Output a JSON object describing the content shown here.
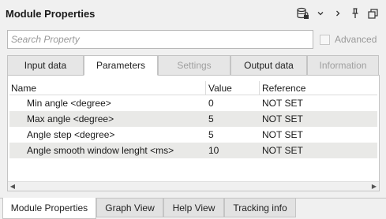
{
  "window": {
    "title": "Module Properties",
    "icons": [
      "database-lock-icon",
      "chevron-down-icon",
      "chevron-right-icon",
      "pin-icon",
      "restore-icon"
    ]
  },
  "search": {
    "placeholder": "Search Property",
    "value": ""
  },
  "advanced": {
    "label": "Advanced",
    "checked": false
  },
  "tabs": [
    {
      "label": "Input data",
      "active": false,
      "enabled": true
    },
    {
      "label": "Parameters",
      "active": true,
      "enabled": true
    },
    {
      "label": "Settings",
      "active": false,
      "enabled": false
    },
    {
      "label": "Output data",
      "active": false,
      "enabled": true
    },
    {
      "label": "Information",
      "active": false,
      "enabled": false
    }
  ],
  "grid": {
    "columns": [
      "Name",
      "Value",
      "Reference"
    ],
    "rows": [
      {
        "name": "Min angle <degree>",
        "value": "0",
        "reference": "NOT SET"
      },
      {
        "name": "Max angle <degree>",
        "value": "5",
        "reference": "NOT SET"
      },
      {
        "name": "Angle step <degree>",
        "value": "5",
        "reference": "NOT SET"
      },
      {
        "name": "Angle smooth window lenght <ms>",
        "value": "10",
        "reference": "NOT SET"
      }
    ]
  },
  "bottom_tabs": [
    {
      "label": "Module Properties",
      "active": true
    },
    {
      "label": "Graph View",
      "active": false
    },
    {
      "label": "Help View",
      "active": false
    },
    {
      "label": "Tracking info",
      "active": false
    }
  ]
}
